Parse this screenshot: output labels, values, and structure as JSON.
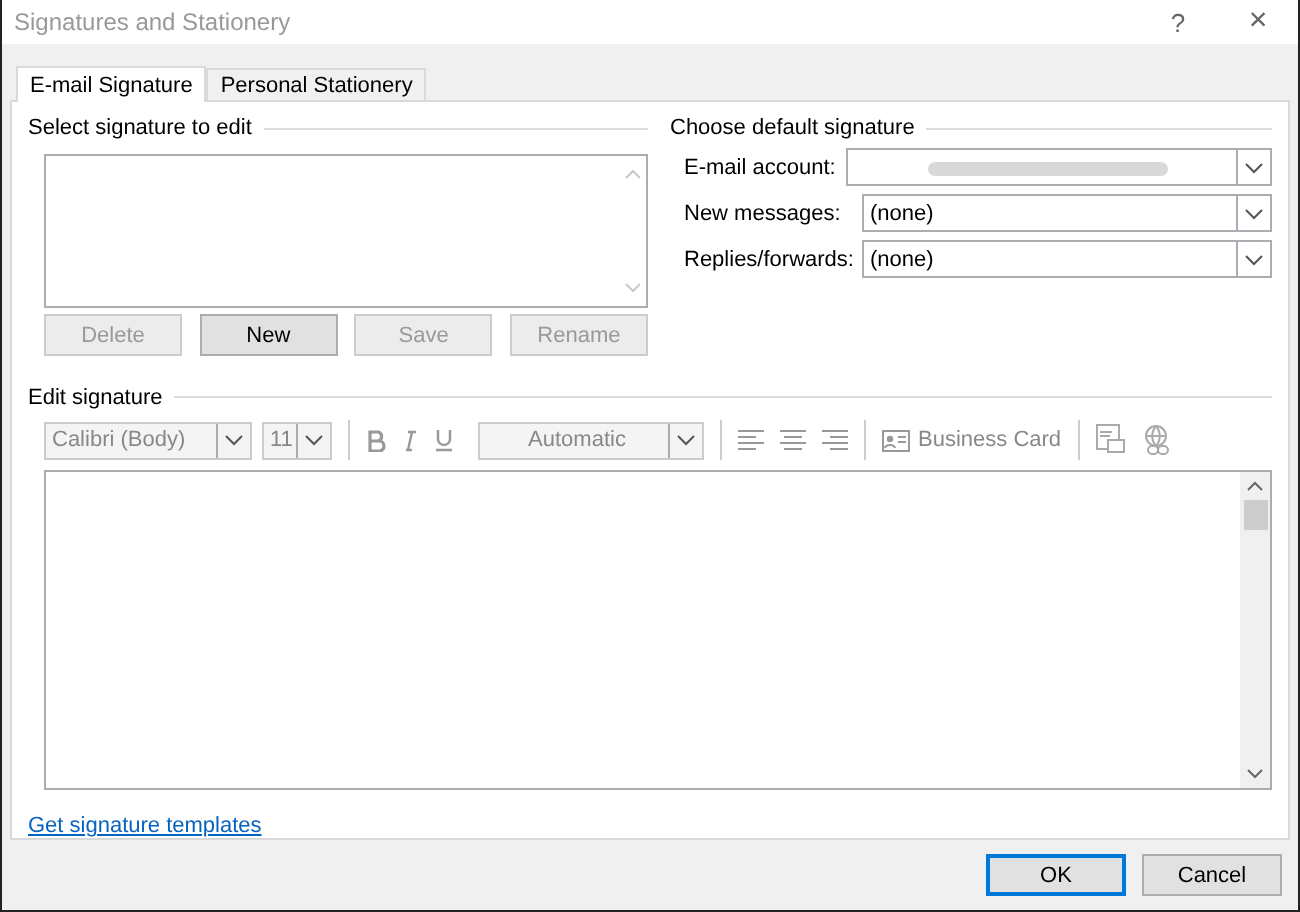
{
  "window": {
    "title": "Signatures and Stationery",
    "help_button": "?",
    "close_button": "×"
  },
  "tabs": [
    {
      "label": "E-mail Signature",
      "selected": true
    },
    {
      "label": "Personal Stationery",
      "selected": false
    }
  ],
  "select_signature": {
    "heading": "Select signature to edit",
    "buttons": [
      {
        "label": "Delete",
        "disabled": true
      },
      {
        "label": "New",
        "disabled": false
      },
      {
        "label": "Save",
        "disabled": true
      },
      {
        "label": "Rename",
        "disabled": true
      }
    ]
  },
  "default_signature": {
    "heading": "Choose default signature",
    "fields": [
      {
        "label": "E-mail account:",
        "kind": "blurred"
      },
      {
        "label": "New messages:",
        "kind": "text",
        "value": "(none)"
      },
      {
        "label": "Replies/forwards:",
        "kind": "text",
        "value": "(none)"
      }
    ]
  },
  "edit_signature": {
    "heading": "Edit signature",
    "disabled": true,
    "font": "Calibri (Body)",
    "size": "11",
    "font_color": "Automatic",
    "business_card": "Business Card"
  },
  "link": "Get signature templates",
  "footer_buttons": [
    {
      "label": "OK",
      "default": true
    },
    {
      "label": "Cancel",
      "default": false
    }
  ]
}
